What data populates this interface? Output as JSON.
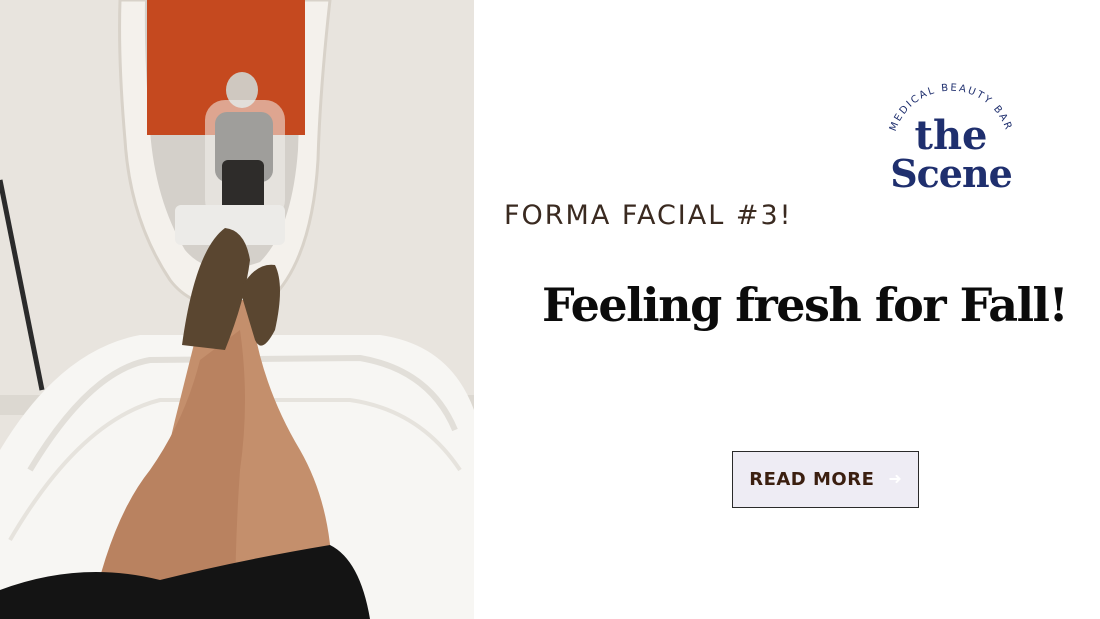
{
  "photo": {
    "description_icon": "spa-chair-photo"
  },
  "logo": {
    "tagline": "MEDICAL BEAUTY BAR",
    "line1": "the",
    "line2": "Scene",
    "color": "#1f2f6e"
  },
  "post": {
    "eyebrow": "FORMA FACIAL #3!",
    "headline": "Feeling fresh for Fall!"
  },
  "cta": {
    "label": "READ MORE",
    "icon": "arrow-right-icon"
  }
}
